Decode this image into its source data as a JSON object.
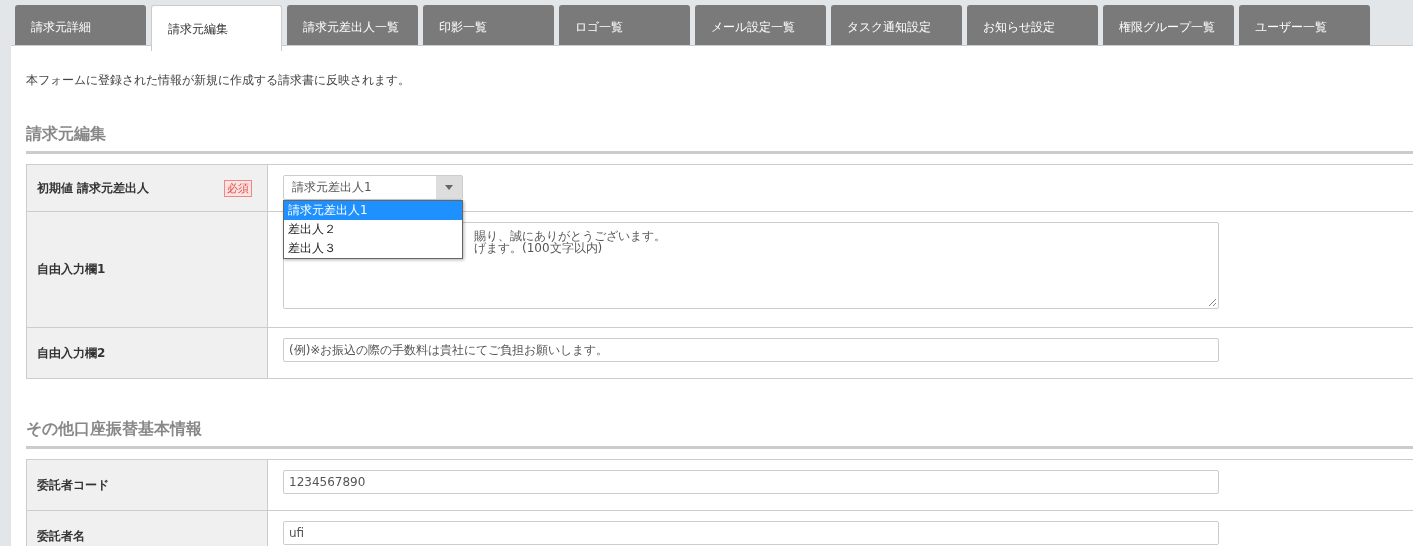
{
  "tabs": [
    {
      "label": "請求元詳細",
      "selected": false
    },
    {
      "label": "請求元編集",
      "selected": true
    },
    {
      "label": "請求元差出人一覧",
      "selected": false
    },
    {
      "label": "印影一覧",
      "selected": false
    },
    {
      "label": "ロゴ一覧",
      "selected": false
    },
    {
      "label": "メール設定一覧",
      "selected": false
    },
    {
      "label": "タスク通知設定",
      "selected": false
    },
    {
      "label": "お知らせ設定",
      "selected": false
    },
    {
      "label": "権限グループ一覧",
      "selected": false
    },
    {
      "label": "ユーザー一覧",
      "selected": false
    }
  ],
  "notice": "本フォームに登録された情報が新規に作成する請求書に反映されます。",
  "sections": [
    {
      "title": "請求元編集",
      "rows": [
        {
          "kind": "select",
          "label": "初期値 請求元差出人",
          "required_badge": "必須",
          "value": "請求元差出人1",
          "expanded": true,
          "options": [
            {
              "label": "請求元差出人1",
              "selected": true
            },
            {
              "label": "差出人２",
              "selected": false
            },
            {
              "label": "差出人３",
              "selected": false
            }
          ]
        },
        {
          "kind": "textarea",
          "label": "自由入力欄1",
          "placeholder_lines": [
            "賜り、誠にありがとうございます。",
            "げます。(100文字以内)"
          ]
        },
        {
          "kind": "input",
          "label": "自由入力欄2",
          "placeholder": "(例)※お振込の際の手数料は貴社にてご負担お願いします。"
        }
      ]
    },
    {
      "title": "その他口座振替基本情報",
      "rows": [
        {
          "kind": "input",
          "label": "委託者コード",
          "value": "1234567890"
        },
        {
          "kind": "input",
          "label": "委託者名",
          "value": "ufi"
        }
      ]
    }
  ]
}
